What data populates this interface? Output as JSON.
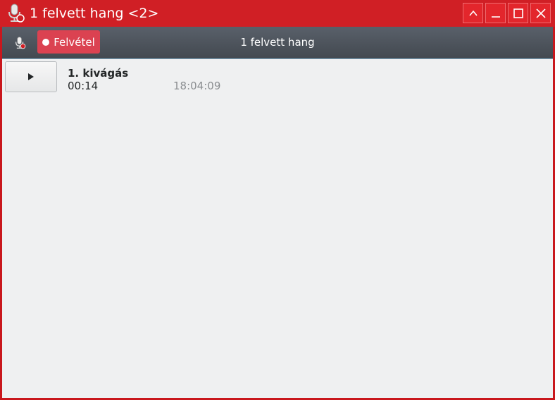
{
  "window": {
    "title": "1 felvett hang <2>",
    "icon": "microphone-icon",
    "controls": [
      "keep-above-icon",
      "minimize-icon",
      "maximize-icon",
      "close-icon"
    ],
    "accent_color": "#d01f25"
  },
  "toolbar": {
    "mic_icon": "microphone-icon",
    "record_label": "Felvétel",
    "record_color": "#db4251",
    "title": "1 felvett hang"
  },
  "recordings": [
    {
      "name": "1. kivágás",
      "duration": "00:14",
      "time": "18:04:09",
      "action_icon": "play-icon"
    }
  ]
}
